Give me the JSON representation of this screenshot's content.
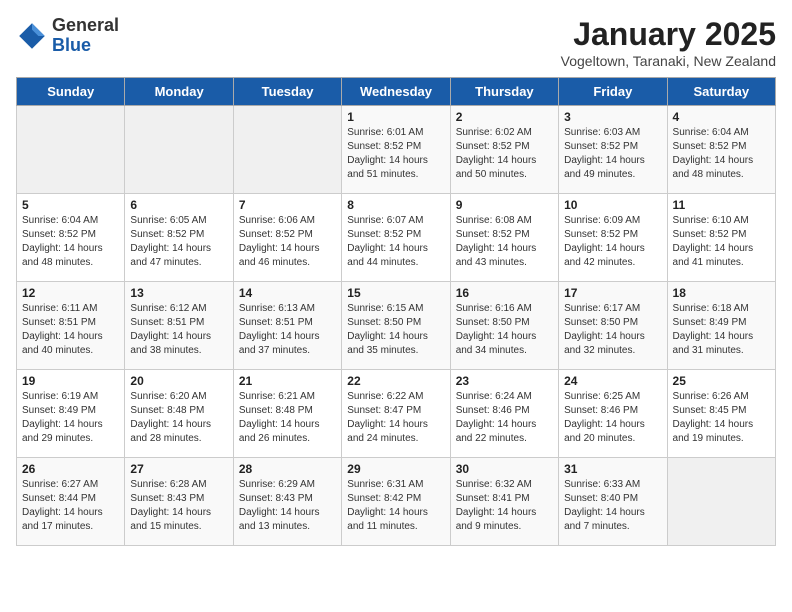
{
  "logo": {
    "general": "General",
    "blue": "Blue"
  },
  "header": {
    "title": "January 2025",
    "location": "Vogeltown, Taranaki, New Zealand"
  },
  "weekdays": [
    "Sunday",
    "Monday",
    "Tuesday",
    "Wednesday",
    "Thursday",
    "Friday",
    "Saturday"
  ],
  "weeks": [
    [
      {
        "day": "",
        "info": ""
      },
      {
        "day": "",
        "info": ""
      },
      {
        "day": "",
        "info": ""
      },
      {
        "day": "1",
        "info": "Sunrise: 6:01 AM\nSunset: 8:52 PM\nDaylight: 14 hours\nand 51 minutes."
      },
      {
        "day": "2",
        "info": "Sunrise: 6:02 AM\nSunset: 8:52 PM\nDaylight: 14 hours\nand 50 minutes."
      },
      {
        "day": "3",
        "info": "Sunrise: 6:03 AM\nSunset: 8:52 PM\nDaylight: 14 hours\nand 49 minutes."
      },
      {
        "day": "4",
        "info": "Sunrise: 6:04 AM\nSunset: 8:52 PM\nDaylight: 14 hours\nand 48 minutes."
      }
    ],
    [
      {
        "day": "5",
        "info": "Sunrise: 6:04 AM\nSunset: 8:52 PM\nDaylight: 14 hours\nand 48 minutes."
      },
      {
        "day": "6",
        "info": "Sunrise: 6:05 AM\nSunset: 8:52 PM\nDaylight: 14 hours\nand 47 minutes."
      },
      {
        "day": "7",
        "info": "Sunrise: 6:06 AM\nSunset: 8:52 PM\nDaylight: 14 hours\nand 46 minutes."
      },
      {
        "day": "8",
        "info": "Sunrise: 6:07 AM\nSunset: 8:52 PM\nDaylight: 14 hours\nand 44 minutes."
      },
      {
        "day": "9",
        "info": "Sunrise: 6:08 AM\nSunset: 8:52 PM\nDaylight: 14 hours\nand 43 minutes."
      },
      {
        "day": "10",
        "info": "Sunrise: 6:09 AM\nSunset: 8:52 PM\nDaylight: 14 hours\nand 42 minutes."
      },
      {
        "day": "11",
        "info": "Sunrise: 6:10 AM\nSunset: 8:52 PM\nDaylight: 14 hours\nand 41 minutes."
      }
    ],
    [
      {
        "day": "12",
        "info": "Sunrise: 6:11 AM\nSunset: 8:51 PM\nDaylight: 14 hours\nand 40 minutes."
      },
      {
        "day": "13",
        "info": "Sunrise: 6:12 AM\nSunset: 8:51 PM\nDaylight: 14 hours\nand 38 minutes."
      },
      {
        "day": "14",
        "info": "Sunrise: 6:13 AM\nSunset: 8:51 PM\nDaylight: 14 hours\nand 37 minutes."
      },
      {
        "day": "15",
        "info": "Sunrise: 6:15 AM\nSunset: 8:50 PM\nDaylight: 14 hours\nand 35 minutes."
      },
      {
        "day": "16",
        "info": "Sunrise: 6:16 AM\nSunset: 8:50 PM\nDaylight: 14 hours\nand 34 minutes."
      },
      {
        "day": "17",
        "info": "Sunrise: 6:17 AM\nSunset: 8:50 PM\nDaylight: 14 hours\nand 32 minutes."
      },
      {
        "day": "18",
        "info": "Sunrise: 6:18 AM\nSunset: 8:49 PM\nDaylight: 14 hours\nand 31 minutes."
      }
    ],
    [
      {
        "day": "19",
        "info": "Sunrise: 6:19 AM\nSunset: 8:49 PM\nDaylight: 14 hours\nand 29 minutes."
      },
      {
        "day": "20",
        "info": "Sunrise: 6:20 AM\nSunset: 8:48 PM\nDaylight: 14 hours\nand 28 minutes."
      },
      {
        "day": "21",
        "info": "Sunrise: 6:21 AM\nSunset: 8:48 PM\nDaylight: 14 hours\nand 26 minutes."
      },
      {
        "day": "22",
        "info": "Sunrise: 6:22 AM\nSunset: 8:47 PM\nDaylight: 14 hours\nand 24 minutes."
      },
      {
        "day": "23",
        "info": "Sunrise: 6:24 AM\nSunset: 8:46 PM\nDaylight: 14 hours\nand 22 minutes."
      },
      {
        "day": "24",
        "info": "Sunrise: 6:25 AM\nSunset: 8:46 PM\nDaylight: 14 hours\nand 20 minutes."
      },
      {
        "day": "25",
        "info": "Sunrise: 6:26 AM\nSunset: 8:45 PM\nDaylight: 14 hours\nand 19 minutes."
      }
    ],
    [
      {
        "day": "26",
        "info": "Sunrise: 6:27 AM\nSunset: 8:44 PM\nDaylight: 14 hours\nand 17 minutes."
      },
      {
        "day": "27",
        "info": "Sunrise: 6:28 AM\nSunset: 8:43 PM\nDaylight: 14 hours\nand 15 minutes."
      },
      {
        "day": "28",
        "info": "Sunrise: 6:29 AM\nSunset: 8:43 PM\nDaylight: 14 hours\nand 13 minutes."
      },
      {
        "day": "29",
        "info": "Sunrise: 6:31 AM\nSunset: 8:42 PM\nDaylight: 14 hours\nand 11 minutes."
      },
      {
        "day": "30",
        "info": "Sunrise: 6:32 AM\nSunset: 8:41 PM\nDaylight: 14 hours\nand 9 minutes."
      },
      {
        "day": "31",
        "info": "Sunrise: 6:33 AM\nSunset: 8:40 PM\nDaylight: 14 hours\nand 7 minutes."
      },
      {
        "day": "",
        "info": ""
      }
    ]
  ]
}
